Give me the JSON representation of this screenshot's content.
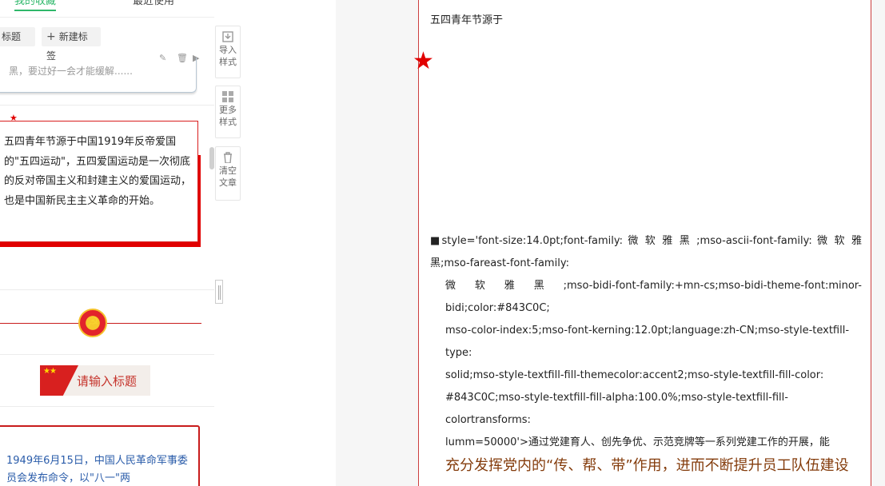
{
  "left_panel": {
    "tabs": [
      "我的收藏",
      "最近使用"
    ],
    "tags": [
      "标题",
      "新建标签"
    ],
    "card1_text": "黑，要过好一会才能缓解......",
    "card2_text": "五四青年节源于中国1919年反帝爱国的\"五四运动\"，五四爱国运动是一次彻底的反对帝国主义和封建主义的爱国运动，也是中国新民主主义革命的开始。",
    "title_placeholder": "请输入标题",
    "card3_text": "1949年6月15日，中国人民革命军事委员会发布命令，以\"八一\"两"
  },
  "toolbar": {
    "import_label": "导入\n样式",
    "more_label": "更多\n样式",
    "clear_label": "清空\n文章"
  },
  "editor": {
    "title": "五四青年节源于",
    "code_lines": [
      "■style='font-size:14.0pt;font-family: 微 软 雅 黑 ;mso-ascii-font-family: 微 软 雅 黑;mso-fareast-font-family:",
      "微 软 雅 黑 ;mso-bidi-font-family:+mn-cs;mso-bidi-theme-font:minor-bidi;color:#843C0C;",
      "mso-color-index:5;mso-font-kerning:12.0pt;language:zh-CN;mso-style-textfill-type:",
      "solid;mso-style-textfill-fill-themecolor:accent2;mso-style-textfill-fill-color:",
      "#843C0C;mso-style-textfill-fill-alpha:100.0%;mso-style-textfill-fill-colortransforms:",
      "lumm=50000'>通过党建育人、创先争优、示范竞牌等一系列党建工作的开展，能"
    ],
    "big_text": "充分发挥党内的“传、帮、带”作用，进而不断提升员工队伍建设"
  }
}
